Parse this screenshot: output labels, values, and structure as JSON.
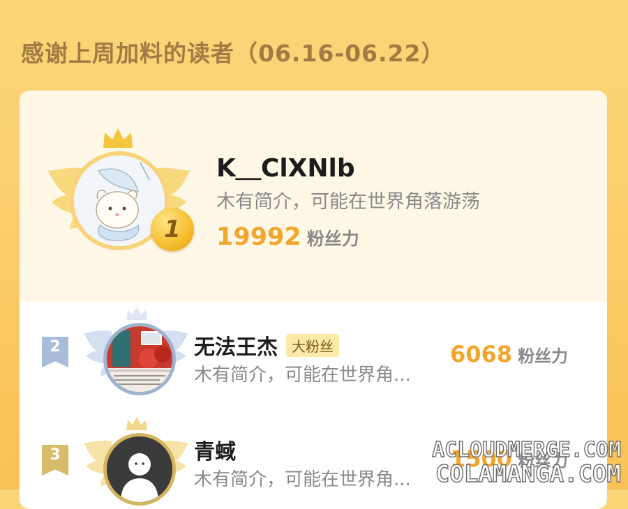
{
  "page": {
    "title": "感谢上周加料的读者（06.16-06.22）"
  },
  "ranking": [
    {
      "rank": "1",
      "name": "K＿ClXNlb",
      "bio": "木有简介，可能在世界角落游荡",
      "score": "19992",
      "score_unit": "粉丝力",
      "avatar_icon": "sheep-cartoon-avatar"
    },
    {
      "rank": "2",
      "name": "无法王杰",
      "tag": "大粉丝",
      "bio": "木有简介，可能在世界角...",
      "score": "6068",
      "score_unit": "粉丝力",
      "avatar_icon": "red-door-photo-avatar"
    },
    {
      "rank": "3",
      "name": "青蜮",
      "bio": "木有简介，可能在世界角...",
      "score": "1500",
      "score_unit": "粉丝力",
      "avatar_icon": "default-user-avatar"
    }
  ],
  "watermark": {
    "line1": "ACLOUDMERGE.COM",
    "line2": "COLAMANGA.COM"
  },
  "colors": {
    "background": "#fbd679",
    "score": "#f2a62c",
    "gold": "#f5bd2c",
    "silver": "#9fb3cf",
    "bronze": "#d4b45c"
  }
}
